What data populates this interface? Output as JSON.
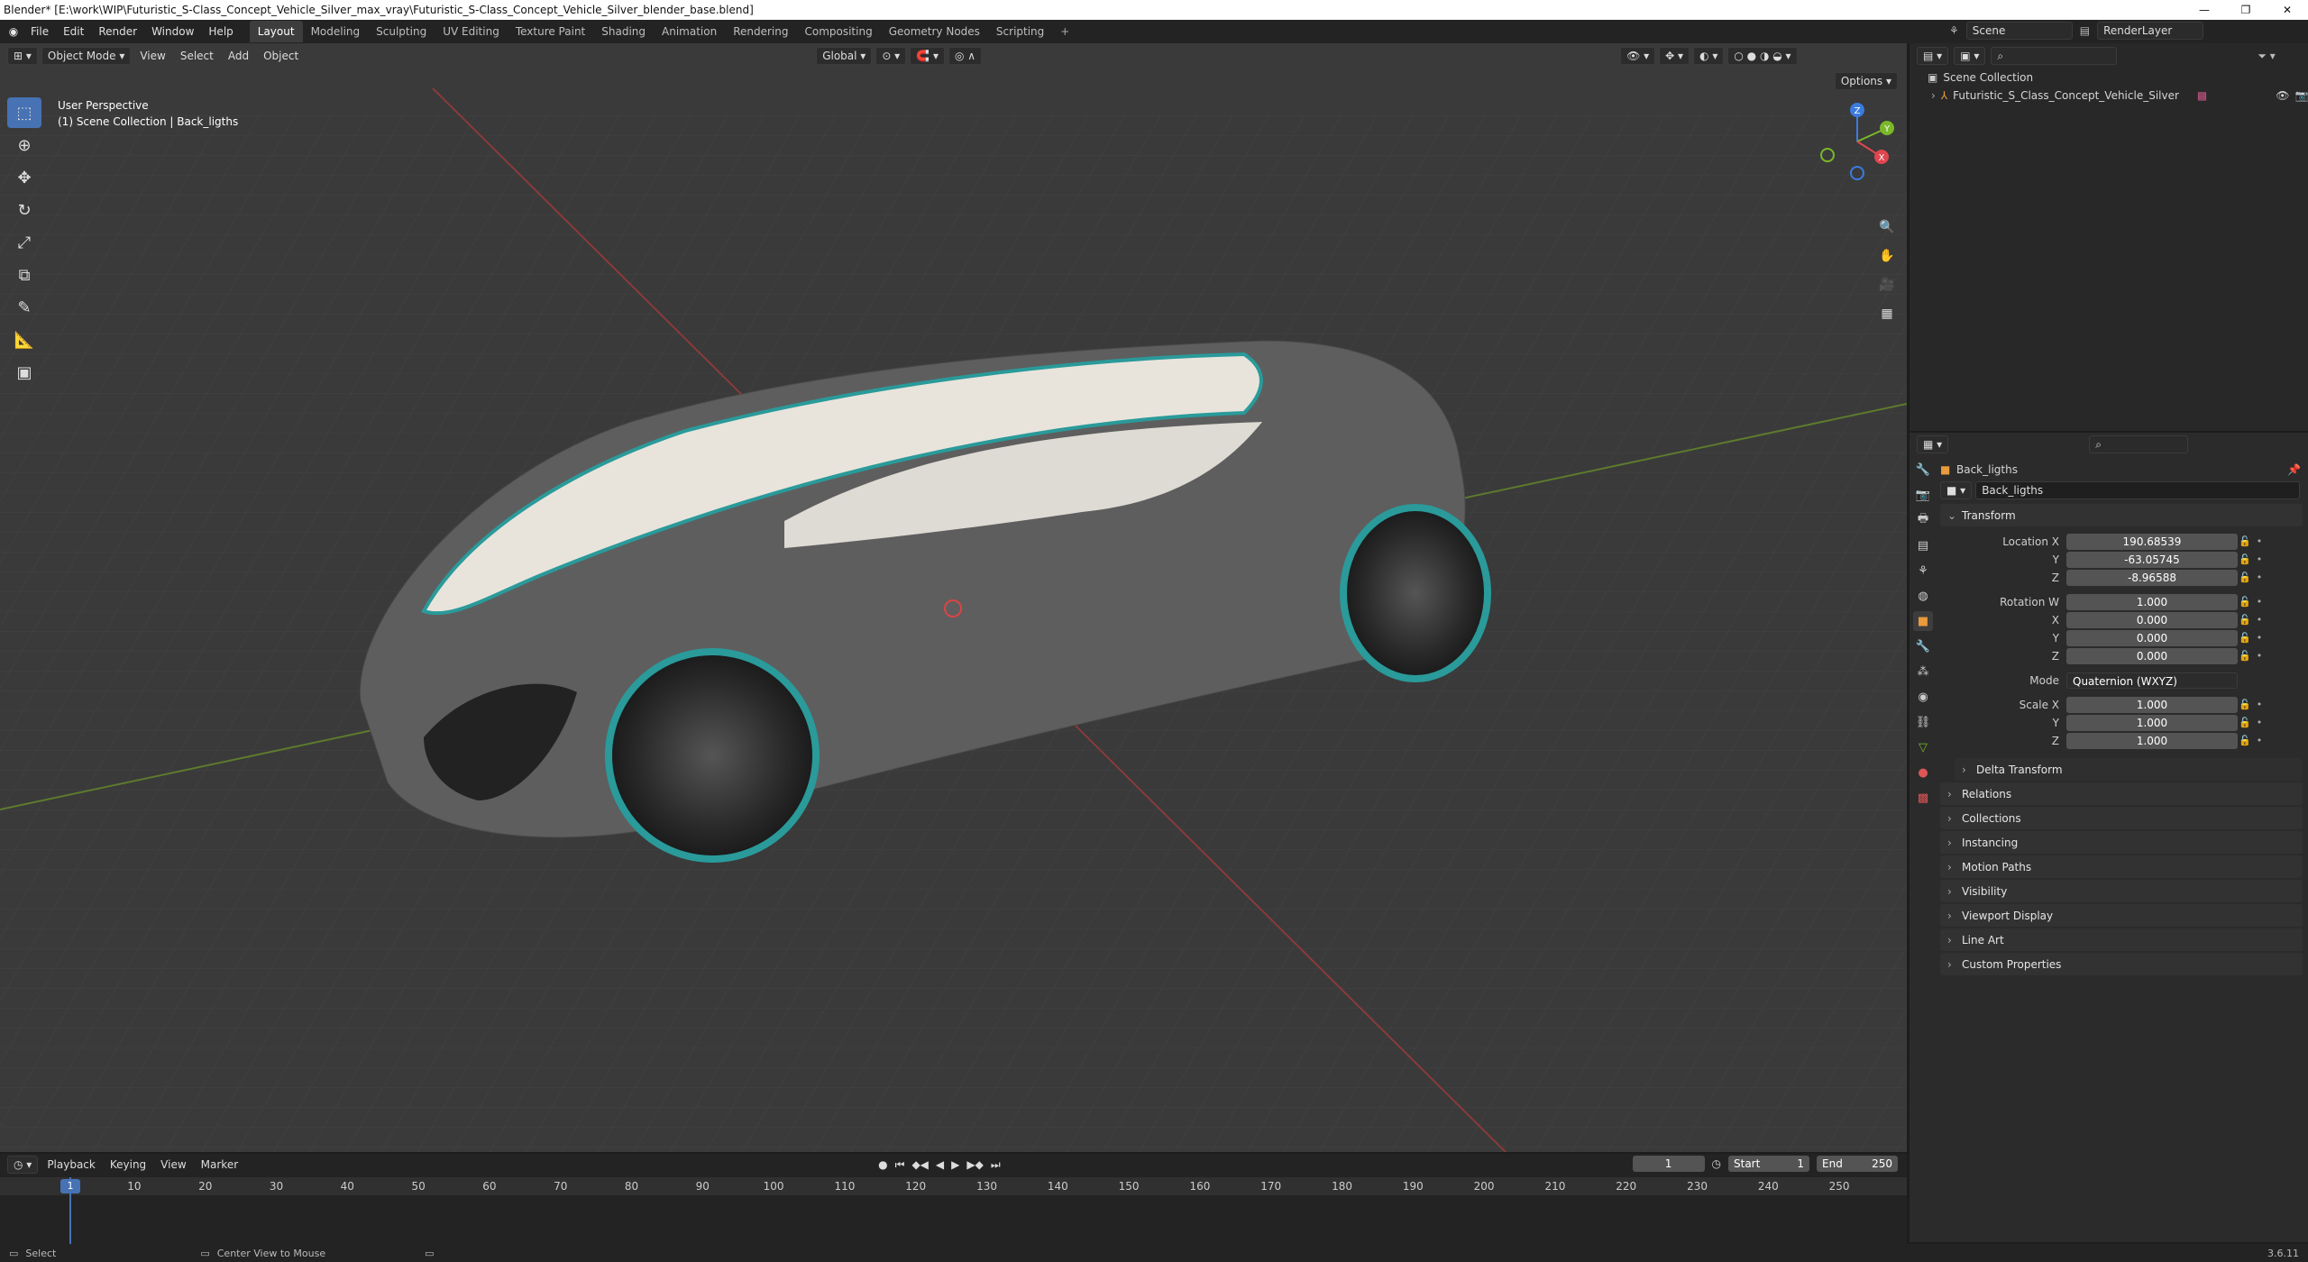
{
  "window": {
    "title": "Blender* [E:\\work\\WIP\\Futuristic_S-Class_Concept_Vehicle_Silver_max_vray\\Futuristic_S-Class_Concept_Vehicle_Silver_blender_base.blend]"
  },
  "menu": [
    "File",
    "Edit",
    "Render",
    "Window",
    "Help"
  ],
  "workspaces": [
    "Layout",
    "Modeling",
    "Sculpting",
    "UV Editing",
    "Texture Paint",
    "Shading",
    "Animation",
    "Rendering",
    "Compositing",
    "Geometry Nodes",
    "Scripting"
  ],
  "scene": {
    "scene_name": "Scene",
    "view_layer": "RenderLayer"
  },
  "viewport": {
    "mode": "Object Mode",
    "menu": [
      "View",
      "Select",
      "Add",
      "Object"
    ],
    "orientation": "Global",
    "options": "Options",
    "overlay_line1": "User Perspective",
    "overlay_line2": "(1) Scene Collection | Back_ligths",
    "gizmo_axes": [
      "X",
      "Y",
      "Z"
    ]
  },
  "outliner": {
    "root": "Scene Collection",
    "object": "Futuristic_S_Class_Concept_Vehicle_Silver"
  },
  "properties": {
    "object_name": "Back_ligths",
    "data_name": "Back_ligths",
    "transform_label": "Transform",
    "location": {
      "label_x": "Location X",
      "x": "190.68539",
      "y": "-63.05745",
      "z": "-8.96588"
    },
    "rotation": {
      "label_w": "Rotation W",
      "w": "1.000",
      "x": "0.000",
      "y": "0.000",
      "z": "0.000"
    },
    "mode_label": "Mode",
    "mode_value": "Quaternion (WXYZ)",
    "scale": {
      "label_x": "Scale X",
      "x": "1.000",
      "y": "1.000",
      "z": "1.000"
    },
    "axis": {
      "y": "Y",
      "z": "Z",
      "x": "X"
    },
    "delta": "Delta Transform",
    "sections": [
      "Relations",
      "Collections",
      "Instancing",
      "Motion Paths",
      "Visibility",
      "Viewport Display",
      "Line Art",
      "Custom Properties"
    ]
  },
  "timeline": {
    "menu": [
      "Playback",
      "Keying",
      "View",
      "Marker"
    ],
    "current_frame": "1",
    "start_label": "Start",
    "start": "1",
    "end_label": "End",
    "end": "250",
    "ticks": [
      "1",
      "10",
      "20",
      "30",
      "40",
      "50",
      "60",
      "70",
      "80",
      "90",
      "100",
      "110",
      "120",
      "130",
      "140",
      "150",
      "160",
      "170",
      "180",
      "190",
      "200",
      "210",
      "220",
      "230",
      "240",
      "250"
    ]
  },
  "status": {
    "select": "Select",
    "center": "Center View to Mouse",
    "version": "3.6.11"
  },
  "colors": {
    "accent": "#4772b3",
    "viewport_bg": "#3a3a3a",
    "panel_bg": "#2b2b2b"
  }
}
